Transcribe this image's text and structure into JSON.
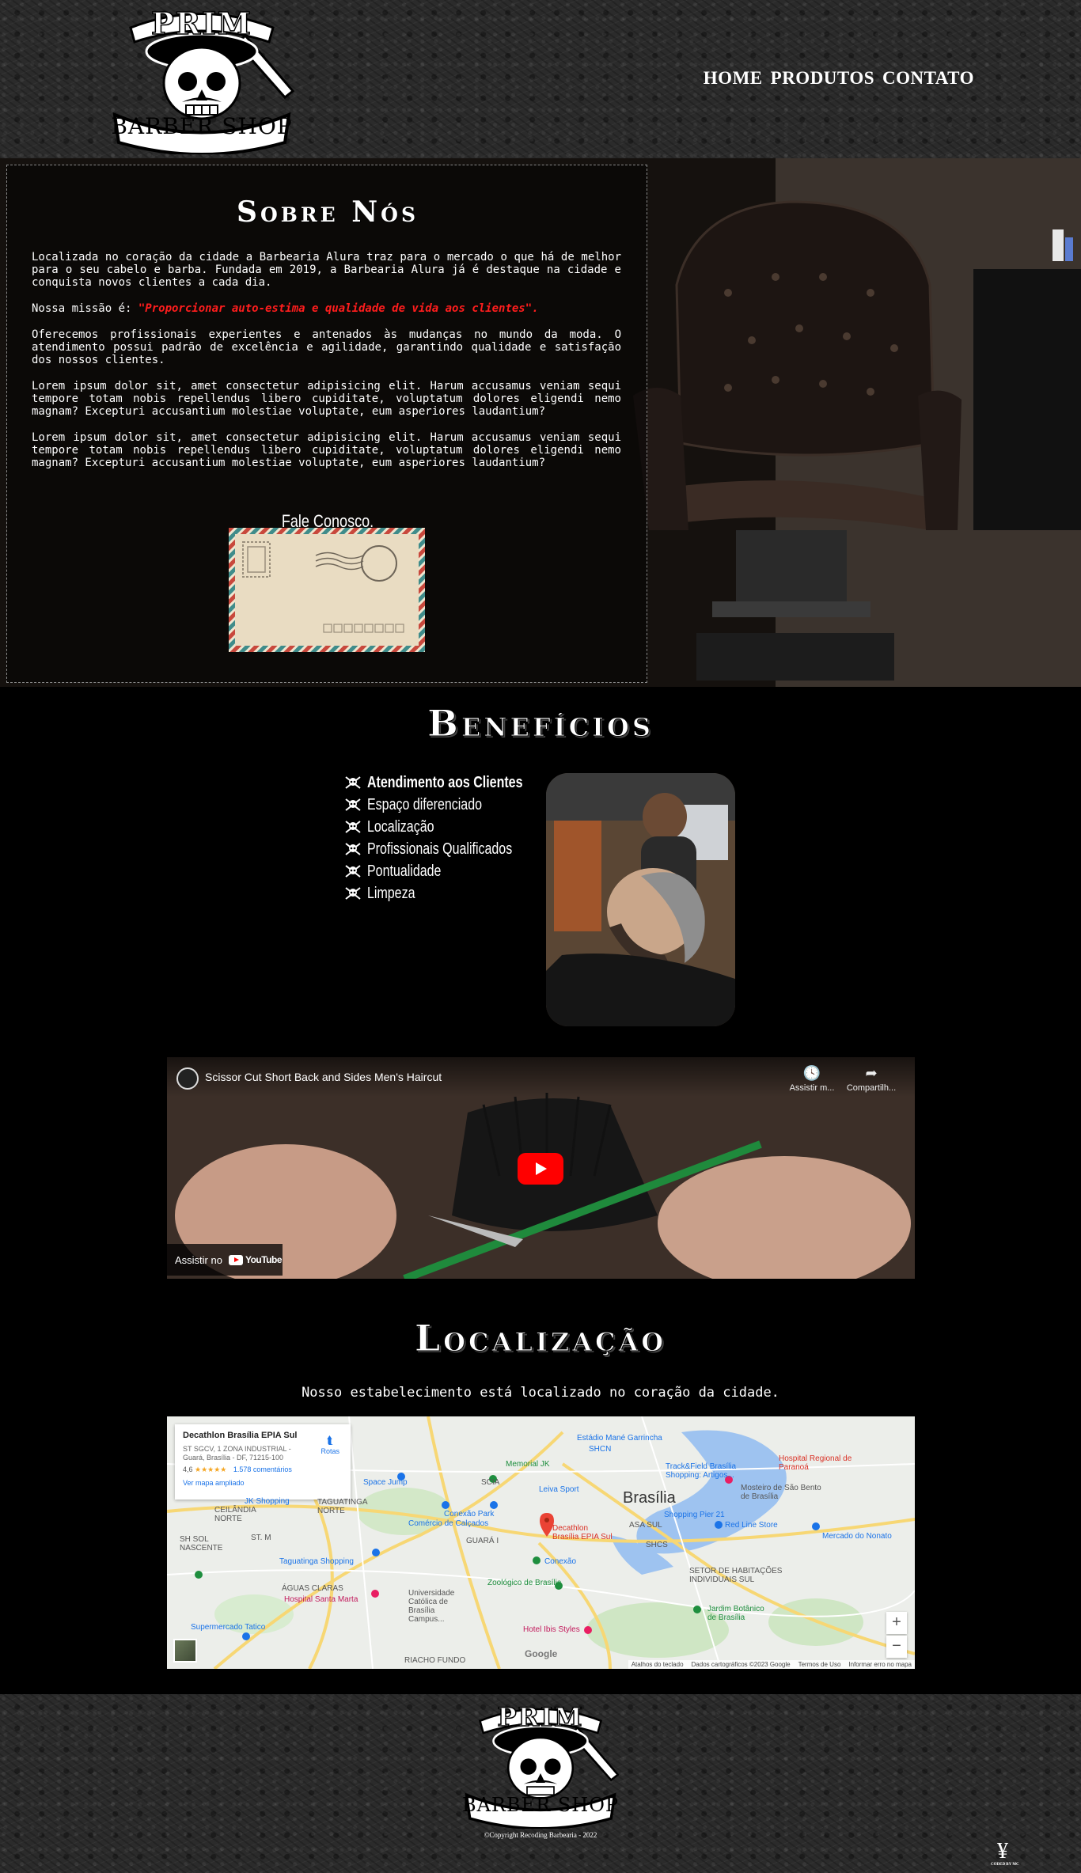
{
  "header": {
    "logo": {
      "top": "PRIM",
      "bottom": "BARBER SHOP"
    },
    "nav": [
      "HOME",
      "PRODUTOS",
      "CONTATO"
    ]
  },
  "about": {
    "title": "Sobre Nós",
    "paragraph1": "Localizada no coração da cidade a Barbearia Alura traz para o mercado o que há de melhor para o seu cabelo e barba. Fundada em 2019, a Barbearia Alura já é destaque na cidade e conquista novos clientes a cada dia.",
    "mission_prefix": "Nossa missão é: ",
    "mission": "\"Proporcionar auto-estima e qualidade de vida aos clientes\".",
    "paragraph2": "Oferecemos profissionais experientes e antenados às mudanças no mundo da moda. O atendimento possui padrão de excelência e agilidade, garantindo qualidade e satisfação dos nossos clientes.",
    "paragraph3": "Lorem ipsum dolor sit, amet consectetur adipisicing elit. Harum accusamus veniam sequi tempore totam nobis repellendus libero cupiditate, voluptatum dolores eligendi nemo magnam? Excepturi accusantium molestiae voluptate, eum asperiores laudantium?",
    "paragraph4": "Lorem ipsum dolor sit, amet consectetur adipisicing elit. Harum accusamus veniam sequi tempore totam nobis repellendus libero cupiditate, voluptatum dolores eligendi nemo magnam? Excepturi accusantium molestiae voluptate, eum asperiores laudantium?",
    "contact_label": "Fale Conosco."
  },
  "benefits": {
    "title": "Benefícios",
    "items": [
      "Atendimento aos Clientes",
      "Espaço diferenciado",
      "Localização",
      "Profissionais Qualificados",
      "Pontualidade",
      "Limpeza"
    ]
  },
  "video": {
    "title": "Scissor Cut Short Back and Sides Men's Haircut",
    "watch_later": "Assistir m...",
    "share": "Compartilh...",
    "watch_on": "Assistir no",
    "youtube": "YouTube"
  },
  "location": {
    "title": "Localização",
    "text": "Nosso estabelecimento está localizado no coração da cidade.",
    "map": {
      "place_name": "Decathlon Brasília EPIA Sul",
      "address": "ST SGCV, 1 ZONA INDUSTRIAL - Guará, Brasília - DF, 71215-100",
      "rating": "4,6",
      "stars": "★★★★★",
      "reviews": "1.578 comentários",
      "routes": "Rotas",
      "bigger_map": "Ver mapa ampliado",
      "city": "Brasília",
      "pin_label": "Decathlon Brasília EPIA Sul",
      "labels": {
        "estadio": "Estádio Mané Garrincha",
        "memorial": "Memorial JK",
        "track": "Track&Field Brasília Shopping: Artigos...",
        "hospital_reg": "Hospital Regional de Paranoá",
        "mosteiro": "Mosteiro de São Bento de Brasília",
        "space_jump": "Space Jump",
        "leiva": "Leiva Sport",
        "jk": "JK Shopping",
        "taguatinga_norte": "TAGUATINGA NORTE",
        "ceilandia": "CEILÂNDIA NORTE",
        "conexao_park": "Conexão Park",
        "comercio": "Comércio de Calçados",
        "shopping_pier": "Shopping Pier 21",
        "red_line": "Red Line Store",
        "mercado": "Mercado do Nonato",
        "sol_nascente": "SH SOL NASCENTE",
        "taguatinga_shop": "Taguatinga Shopping",
        "conexao": "Conexão",
        "zoologico": "Zoológico de Brasília",
        "habitacoes": "SETOR DE HABITAÇÕES INDIVIDUAIS SUL",
        "jardim": "Jardim Botânico de Brasília",
        "santa_marta": "Hospital Santa Marta",
        "catolica": "Universidade Católica de Brasília Campus...",
        "tatico": "Supermercado Tatico",
        "ibis": "Hotel Ibis Styles",
        "riacho": "RIACHO FUNDO",
        "aguas": "ÁGUAS CLARAS",
        "guara": "GUARÁ I",
        "scia": "SCIA",
        "shcn": "SHCN",
        "asa_sul": "ASA SUL",
        "shcs": "SHCS",
        "st_m": "ST. M",
        "google": "Google"
      },
      "footer": [
        "Atalhos do teclado",
        "Dados cartográficos ©2023 Google",
        "Termos de Uso",
        "Informar erro no mapa"
      ]
    }
  },
  "footer": {
    "logo": {
      "top": "PRIM",
      "bottom": "BARBER SHOP"
    },
    "copyright": "©Copyright Recoding Barbearia - 2022",
    "coder_symbol": "¥",
    "coder_caption": "CODED BY MC"
  }
}
